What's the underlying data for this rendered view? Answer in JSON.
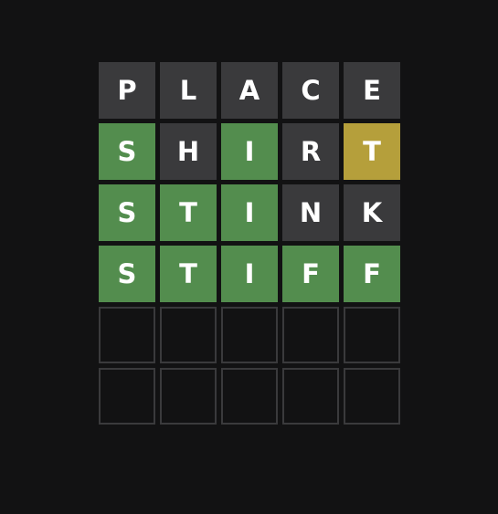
{
  "board": {
    "rows": [
      [
        {
          "letter": "P",
          "state": "absent"
        },
        {
          "letter": "L",
          "state": "absent"
        },
        {
          "letter": "A",
          "state": "absent"
        },
        {
          "letter": "C",
          "state": "absent"
        },
        {
          "letter": "E",
          "state": "absent"
        }
      ],
      [
        {
          "letter": "S",
          "state": "correct"
        },
        {
          "letter": "H",
          "state": "absent"
        },
        {
          "letter": "I",
          "state": "correct"
        },
        {
          "letter": "R",
          "state": "absent"
        },
        {
          "letter": "T",
          "state": "present"
        }
      ],
      [
        {
          "letter": "S",
          "state": "correct"
        },
        {
          "letter": "T",
          "state": "correct"
        },
        {
          "letter": "I",
          "state": "correct"
        },
        {
          "letter": "N",
          "state": "absent"
        },
        {
          "letter": "K",
          "state": "absent"
        }
      ],
      [
        {
          "letter": "S",
          "state": "correct"
        },
        {
          "letter": "T",
          "state": "correct"
        },
        {
          "letter": "I",
          "state": "correct"
        },
        {
          "letter": "F",
          "state": "correct"
        },
        {
          "letter": "F",
          "state": "correct"
        }
      ],
      [
        {
          "letter": "",
          "state": "empty"
        },
        {
          "letter": "",
          "state": "empty"
        },
        {
          "letter": "",
          "state": "empty"
        },
        {
          "letter": "",
          "state": "empty"
        },
        {
          "letter": "",
          "state": "empty"
        }
      ],
      [
        {
          "letter": "",
          "state": "empty"
        },
        {
          "letter": "",
          "state": "empty"
        },
        {
          "letter": "",
          "state": "empty"
        },
        {
          "letter": "",
          "state": "empty"
        },
        {
          "letter": "",
          "state": "empty"
        }
      ]
    ]
  },
  "colors": {
    "background": "#121213",
    "absent": "#3a3a3c",
    "correct": "#538d4e",
    "present": "#b59f3b",
    "empty_border": "#3a3a3c"
  }
}
